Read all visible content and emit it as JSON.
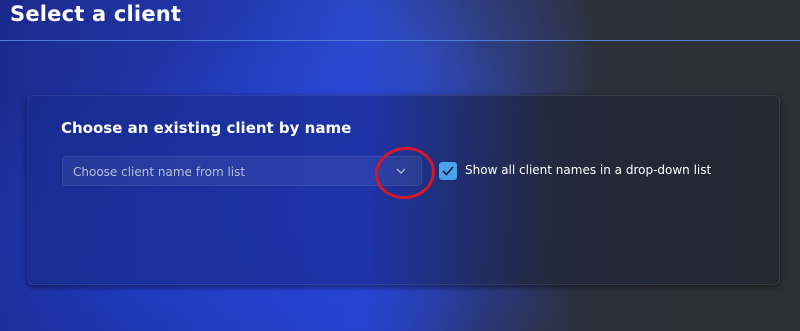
{
  "page": {
    "title": "Select a client"
  },
  "card": {
    "heading": "Choose an existing client by name",
    "combo": {
      "placeholder": "Choose client name from list"
    },
    "checkbox": {
      "label": "Show all client names in a drop-down list",
      "checked": true
    }
  },
  "colors": {
    "accent": "#4aa3e8",
    "annotation": "#d4182a",
    "title_rule": "#4f7ed8"
  },
  "icons": {
    "dropdown": "chevron-down-icon",
    "check": "checkmark-icon"
  }
}
